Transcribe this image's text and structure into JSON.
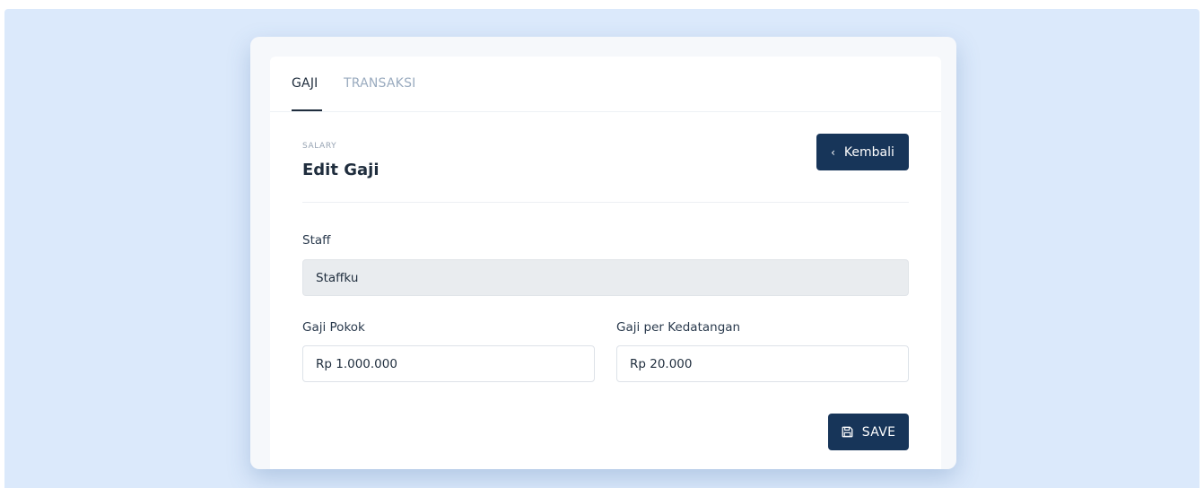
{
  "tabs": [
    {
      "label": "GAJI",
      "active": true
    },
    {
      "label": "TRANSAKSI",
      "active": false
    }
  ],
  "header": {
    "eyebrow": "SALARY",
    "title": "Edit Gaji",
    "back_label": "Kembali",
    "back_icon": "chevron-left-icon"
  },
  "form": {
    "staff": {
      "label": "Staff",
      "value": "Staffku"
    },
    "base_salary": {
      "label": "Gaji Pokok",
      "value": "Rp 1.000.000"
    },
    "per_attendance": {
      "label": "Gaji per Kedatangan",
      "value": "Rp 20.000"
    }
  },
  "actions": {
    "save_label": "SAVE",
    "save_icon": "floppy-disk-icon"
  },
  "colors": {
    "backdrop": "#dbe9fb",
    "primary": "#173559",
    "muted_tab": "#9aabbf",
    "readonly_field": "#e9ecef"
  }
}
